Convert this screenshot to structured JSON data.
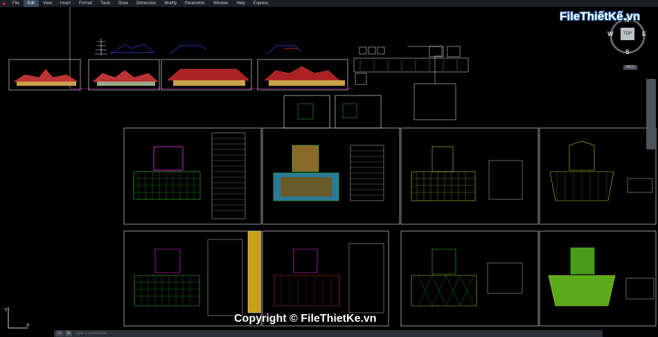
{
  "menubar": {
    "items": [
      "File",
      "Edit",
      "View",
      "Insert",
      "Format",
      "Tools",
      "Draw",
      "Dimension",
      "Modify",
      "Parametric",
      "Window",
      "Help",
      "Express"
    ],
    "active": "Edit"
  },
  "logo": {
    "text": "FileThiếtKế.vn"
  },
  "viewcube": {
    "top_label": "TOP",
    "n": "N",
    "w": "W",
    "e": "E",
    "s": "S"
  },
  "wcs_label": "WCS",
  "ucs": {
    "x": "X",
    "y": "Y"
  },
  "command": {
    "placeholder": "Type a command"
  },
  "watermark": "Copyright © FileThietKe.vn",
  "colors": {
    "background": "#000000",
    "sheet_border": "#ffffff",
    "grid": "#33cc33",
    "accent": "#1f5fa8"
  }
}
